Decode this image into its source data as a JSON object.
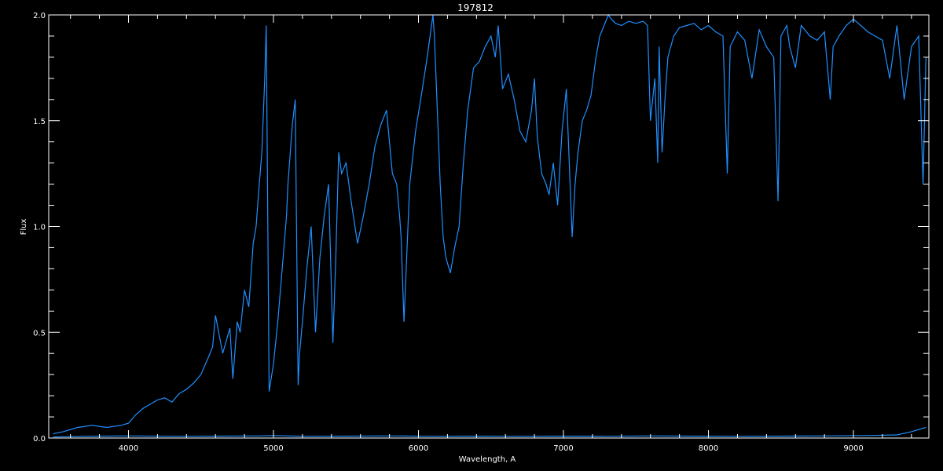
{
  "chart_data": {
    "type": "line",
    "title": "197812",
    "xlabel": "Wavelength, A",
    "ylabel": "Flux",
    "xlim": [
      3450,
      9520
    ],
    "ylim": [
      0,
      2
    ],
    "x_ticks": [
      4000,
      5000,
      6000,
      7000,
      8000,
      9000
    ],
    "y_ticks": [
      0,
      0.5,
      1,
      1.5,
      2
    ],
    "y_tick_labels": [
      "0.0",
      "0.5",
      "1.0",
      "1.5",
      "2.0"
    ],
    "grid": false,
    "colors": {
      "background": "#000000",
      "axes": "#ffffff",
      "series": "#1f8fff"
    },
    "series": [
      {
        "x": [
          3480,
          3550,
          3650,
          3750,
          3850,
          3950,
          4000,
          4050,
          4100,
          4150,
          4200,
          4250,
          4300,
          4350,
          4400,
          4450,
          4500,
          4550,
          4580,
          4600,
          4650,
          4700,
          4720,
          4750,
          4770,
          4800,
          4830,
          4860,
          4880,
          4900,
          4920,
          4940,
          4950,
          4970,
          5000,
          5030,
          5060,
          5090,
          5100,
          5130,
          5150,
          5170,
          5180,
          5200,
          5230,
          5260,
          5290,
          5320,
          5350,
          5380,
          5410,
          5430,
          5450,
          5470,
          5500,
          5540,
          5580,
          5620,
          5660,
          5700,
          5740,
          5780,
          5820,
          5850,
          5870,
          5880,
          5900,
          5940,
          5980,
          6020,
          6060,
          6090,
          6100,
          6110,
          6150,
          6170,
          6190,
          6220,
          6250,
          6280,
          6310,
          6340,
          6380,
          6420,
          6460,
          6500,
          6530,
          6550,
          6580,
          6620,
          6660,
          6700,
          6740,
          6780,
          6800,
          6820,
          6850,
          6880,
          6900,
          6930,
          6960,
          6990,
          7020,
          7060,
          7080,
          7100,
          7130,
          7160,
          7190,
          7220,
          7250,
          7280,
          7310,
          7330,
          7360,
          7400,
          7450,
          7500,
          7550,
          7580,
          7600,
          7630,
          7650,
          7660,
          7680,
          7700,
          7720,
          7760,
          7800,
          7850,
          7900,
          7950,
          8000,
          8050,
          8100,
          8130,
          8150,
          8200,
          8250,
          8300,
          8350,
          8400,
          8450,
          8480,
          8500,
          8540,
          8560,
          8600,
          8640,
          8700,
          8750,
          8800,
          8840,
          8860,
          8900,
          8950,
          9000,
          9050,
          9100,
          9150,
          9200,
          9250,
          9280,
          9300,
          9350,
          9400,
          9450,
          9480,
          9500
        ],
        "y": [
          0.02,
          0.03,
          0.05,
          0.06,
          0.05,
          0.06,
          0.07,
          0.11,
          0.14,
          0.16,
          0.18,
          0.19,
          0.17,
          0.21,
          0.23,
          0.26,
          0.3,
          0.38,
          0.43,
          0.58,
          0.4,
          0.52,
          0.28,
          0.55,
          0.5,
          0.7,
          0.62,
          0.92,
          1.0,
          1.18,
          1.35,
          1.7,
          1.95,
          0.22,
          0.35,
          0.55,
          0.8,
          1.05,
          1.2,
          1.48,
          1.6,
          0.25,
          0.4,
          0.55,
          0.8,
          1.0,
          0.5,
          0.85,
          1.05,
          1.2,
          0.45,
          0.85,
          1.35,
          1.25,
          1.3,
          1.1,
          0.92,
          1.05,
          1.2,
          1.38,
          1.48,
          1.55,
          1.25,
          1.2,
          1.05,
          0.95,
          0.55,
          1.2,
          1.45,
          1.62,
          1.8,
          1.95,
          2.0,
          1.9,
          1.2,
          0.95,
          0.85,
          0.78,
          0.9,
          1.0,
          1.3,
          1.55,
          1.75,
          1.78,
          1.85,
          1.9,
          1.8,
          1.95,
          1.65,
          1.72,
          1.6,
          1.45,
          1.4,
          1.55,
          1.7,
          1.42,
          1.25,
          1.2,
          1.15,
          1.3,
          1.1,
          1.45,
          1.65,
          0.95,
          1.2,
          1.35,
          1.5,
          1.55,
          1.62,
          1.78,
          1.9,
          1.95,
          2.0,
          1.98,
          1.96,
          1.95,
          1.97,
          1.96,
          1.97,
          1.95,
          1.5,
          1.7,
          1.3,
          1.85,
          1.35,
          1.6,
          1.8,
          1.9,
          1.94,
          1.95,
          1.96,
          1.93,
          1.95,
          1.92,
          1.9,
          1.25,
          1.85,
          1.92,
          1.88,
          1.7,
          1.93,
          1.85,
          1.8,
          1.12,
          1.9,
          1.95,
          1.85,
          1.75,
          1.95,
          1.9,
          1.88,
          1.92,
          1.6,
          1.85,
          1.9,
          1.95,
          1.98,
          1.95,
          1.92,
          1.9,
          1.88,
          1.7,
          1.85,
          1.95,
          1.6,
          1.85,
          1.9,
          1.2,
          1.8
        ]
      },
      {
        "x": [
          3480,
          3700,
          4000,
          4300,
          4600,
          4900,
          5000,
          5200,
          5500,
          5800,
          6100,
          6400,
          6700,
          7000,
          7300,
          7600,
          7900,
          8200,
          8500,
          8800,
          9100,
          9300,
          9400,
          9450,
          9500
        ],
        "y": [
          0.005,
          0.008,
          0.01,
          0.008,
          0.009,
          0.01,
          0.012,
          0.008,
          0.009,
          0.01,
          0.008,
          0.009,
          0.008,
          0.009,
          0.008,
          0.01,
          0.009,
          0.008,
          0.009,
          0.01,
          0.012,
          0.015,
          0.03,
          0.04,
          0.05
        ]
      }
    ]
  }
}
